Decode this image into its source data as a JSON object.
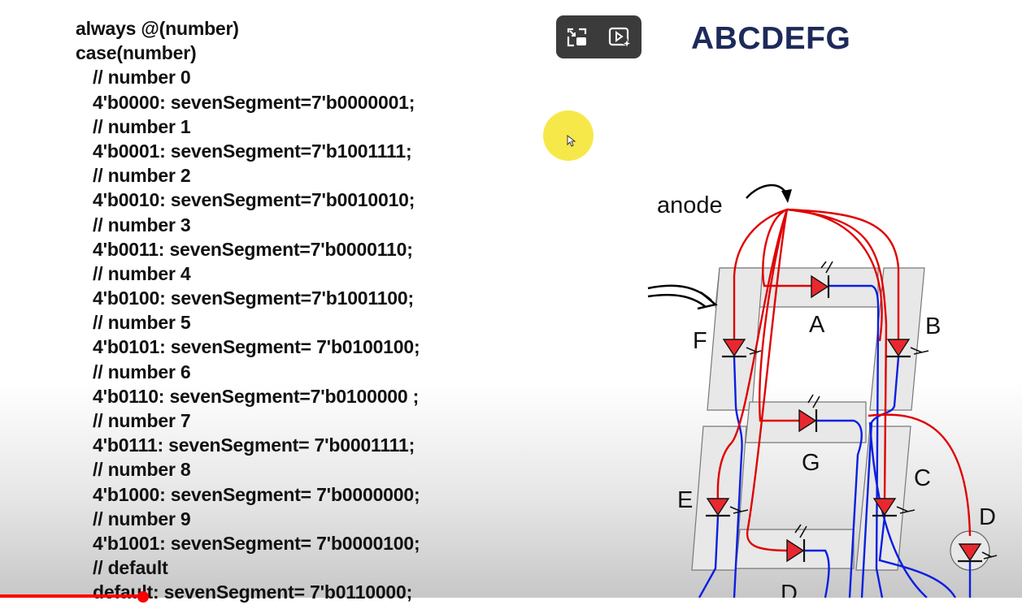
{
  "code": {
    "lines": [
      {
        "text": "always @(number)",
        "indent": false
      },
      {
        "text": "case(number)",
        "indent": false
      },
      {
        "text": "// number 0",
        "indent": true
      },
      {
        "text": "4'b0000: sevenSegment=7'b0000001;",
        "indent": true
      },
      {
        "text": "// number 1",
        "indent": true
      },
      {
        "text": "4'b0001: sevenSegment=7'b1001111;",
        "indent": true
      },
      {
        "text": "// number 2",
        "indent": true
      },
      {
        "text": "4'b0010: sevenSegment=7'b0010010;",
        "indent": true
      },
      {
        "text": "// number 3",
        "indent": true
      },
      {
        "text": "4'b0011: sevenSegment=7'b0000110;",
        "indent": true
      },
      {
        "text": "// number 4",
        "indent": true
      },
      {
        "text": "4'b0100: sevenSegment=7'b1001100;",
        "indent": true
      },
      {
        "text": "// number 5",
        "indent": true
      },
      {
        "text": "4'b0101: sevenSegment= 7'b0100100;",
        "indent": true
      },
      {
        "text": "// number 6",
        "indent": true
      },
      {
        "text": "4'b0110: sevenSegment=7'b0100000 ;",
        "indent": true
      },
      {
        "text": "// number 7",
        "indent": true
      },
      {
        "text": "4'b0111: sevenSegment= 7'b0001111;",
        "indent": true
      },
      {
        "text": "// number 8",
        "indent": true
      },
      {
        "text": "4'b1000: sevenSegment= 7'b0000000;",
        "indent": true
      },
      {
        "text": "// number 9",
        "indent": true
      },
      {
        "text": "4'b1001: sevenSegment= 7'b0000100;",
        "indent": true
      },
      {
        "text": "// default",
        "indent": true
      },
      {
        "text": "default: sevenSegment= 7'b0110000;",
        "indent": true
      }
    ]
  },
  "heading": "ABCDEFG",
  "diagram": {
    "anode_label": "anode",
    "segment_labels": {
      "A": "A",
      "B": "B",
      "C": "C",
      "D": "D",
      "E": "E",
      "F": "F",
      "G": "G",
      "DP": "D"
    }
  },
  "controls": {
    "buttons": [
      {
        "name": "miniplayer-button",
        "icon": "miniplayer-icon"
      },
      {
        "name": "autoplay-button",
        "icon": "video-sparkle-icon"
      }
    ]
  },
  "colors": {
    "heading": "#1d2a5a",
    "cursor_highlight": "#f7e84a",
    "anode_wire": "#e00000",
    "cathode_wire": "#0a1fe0",
    "segment_fill": "#e8e8e8",
    "progress": "#ff0000"
  }
}
